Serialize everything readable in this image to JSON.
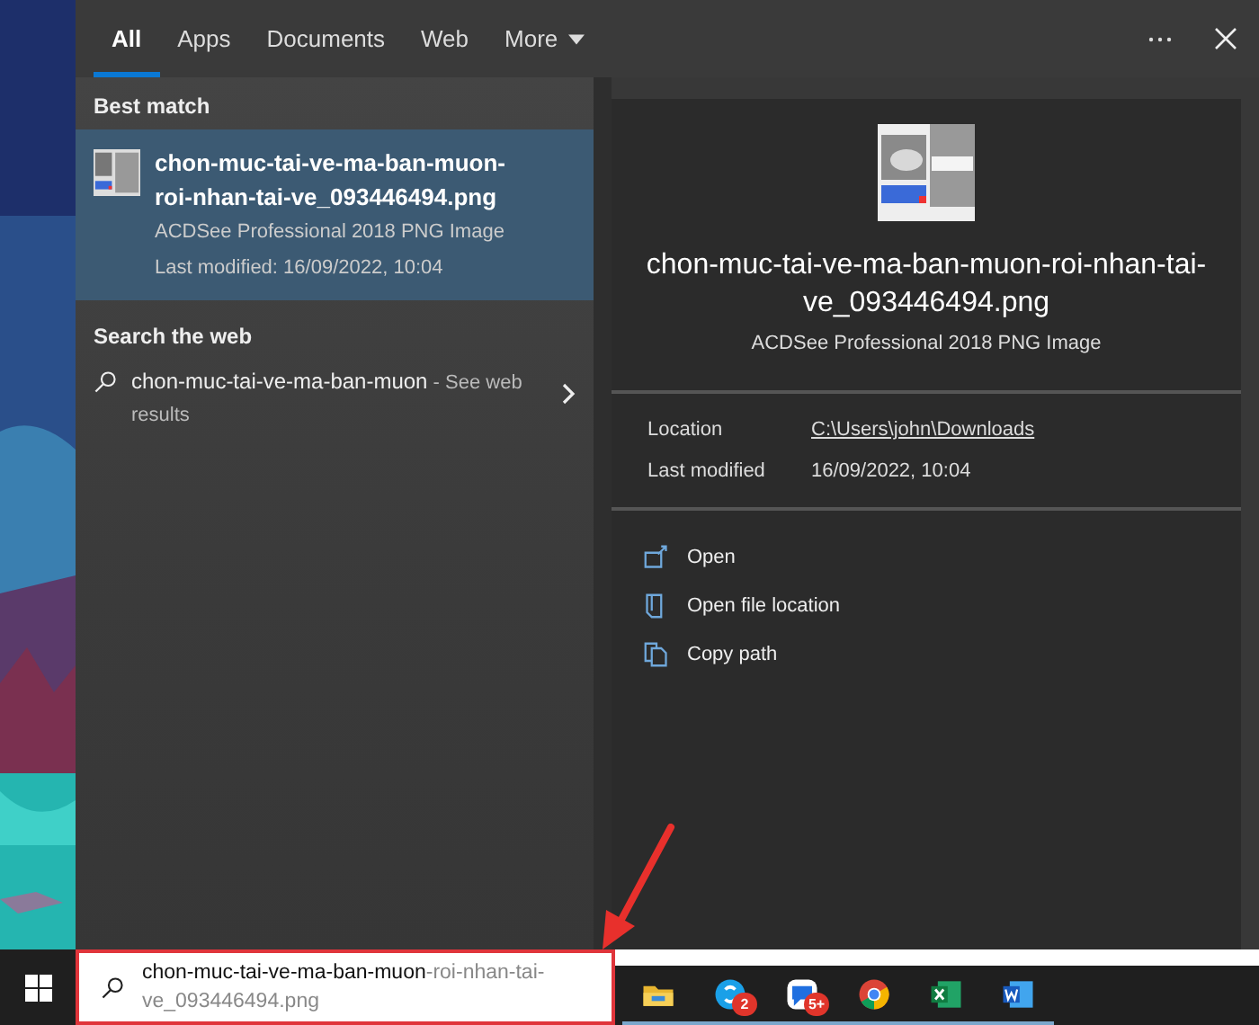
{
  "tabs": [
    {
      "label": "All",
      "selected": true,
      "kind": "tab"
    },
    {
      "label": "Apps",
      "selected": false,
      "kind": "tab"
    },
    {
      "label": "Documents",
      "selected": false,
      "kind": "tab"
    },
    {
      "label": "Web",
      "selected": false,
      "kind": "tab"
    },
    {
      "label": "More",
      "selected": false,
      "kind": "dropdown"
    }
  ],
  "best_match": {
    "heading": "Best match",
    "title": "chon-muc-tai-ve-ma-ban-muon-roi-nhan-tai-ve_093446494.png",
    "type": "ACDSee Professional 2018 PNG Image",
    "modified": "Last modified: 16/09/2022, 10:04",
    "selected": true
  },
  "web": {
    "heading": "Search the web",
    "query": "chon-muc-tai-ve-ma-ban-muon",
    "suffix": " - See web results"
  },
  "preview": {
    "title": "chon-muc-tai-ve-ma-ban-muon-roi-nhan-tai-ve_093446494.png",
    "type": "ACDSee Professional 2018 PNG Image",
    "details": [
      {
        "label": "Location",
        "value": "C:\\Users\\john\\Downloads",
        "kind": "link"
      },
      {
        "label": "Last modified",
        "value": "16/09/2022, 10:04",
        "kind": "text"
      }
    ],
    "actions": [
      {
        "label": "Open",
        "kind": "open"
      },
      {
        "label": "Open file location",
        "kind": "folder"
      },
      {
        "label": "Copy path",
        "kind": "copy"
      }
    ]
  },
  "search": {
    "typed": "chon-muc-tai-ve-ma-ban-muon",
    "completion": "-roi-nhan-tai-ve_093446494.png"
  },
  "taskbar": [
    {
      "kind": "explorer"
    },
    {
      "kind": "skype",
      "badge": "2"
    },
    {
      "kind": "zalo",
      "badge": "5+"
    },
    {
      "kind": "chrome"
    },
    {
      "kind": "excel"
    },
    {
      "kind": "word"
    }
  ]
}
